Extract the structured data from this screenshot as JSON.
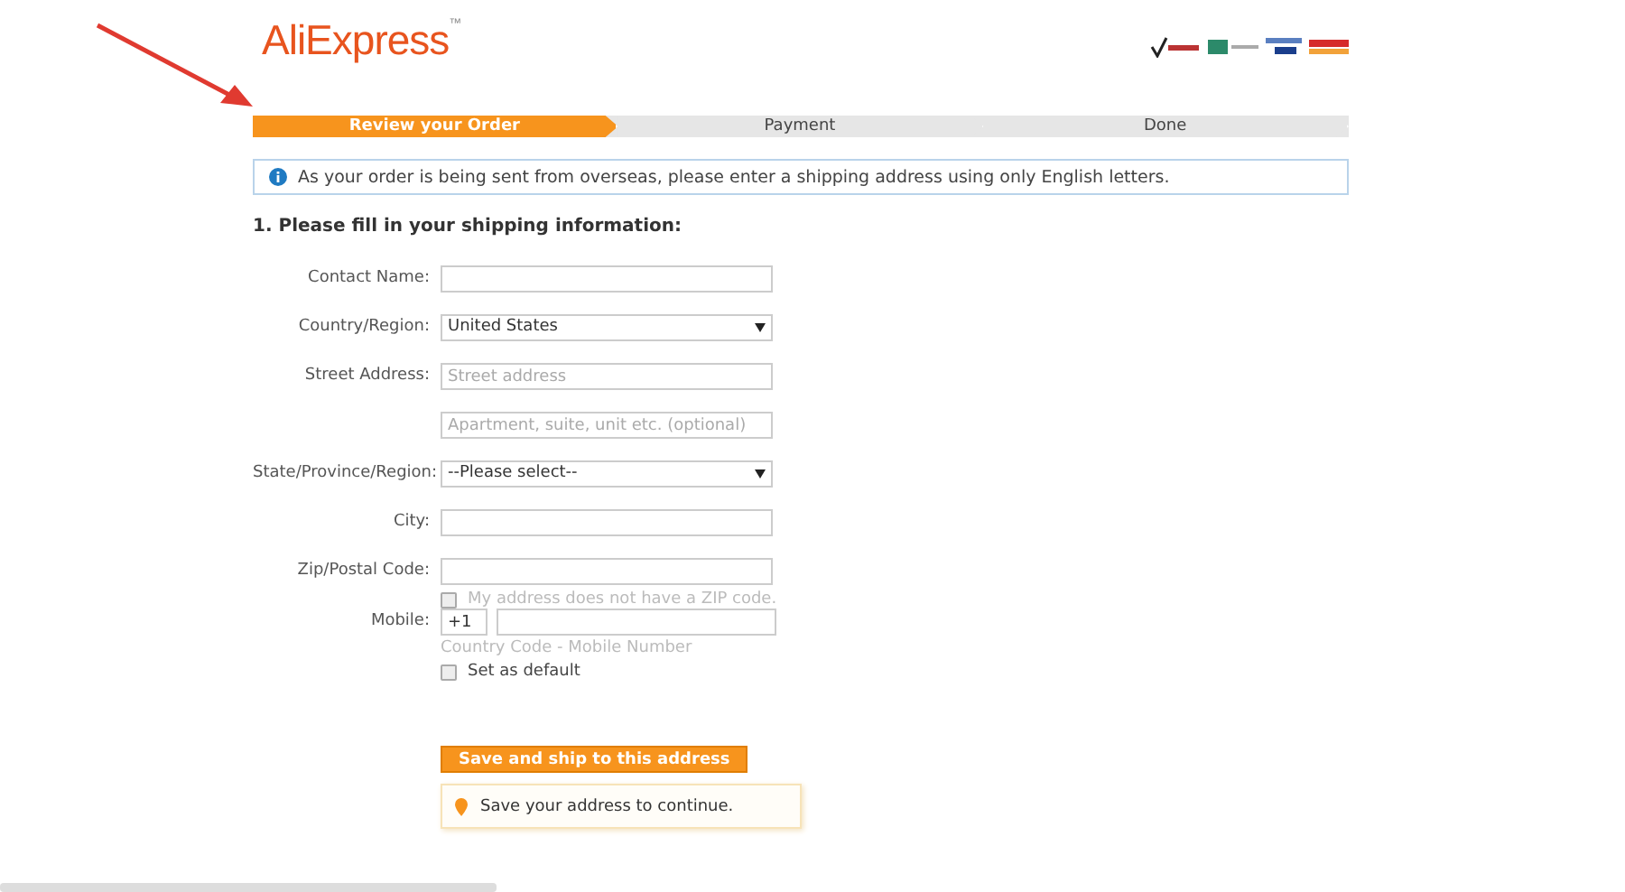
{
  "logo": {
    "text": "AliExpress",
    "mark": "™"
  },
  "steps": [
    {
      "label": "Review your Order",
      "selected": true
    },
    {
      "label": "Payment",
      "selected": false
    },
    {
      "label": "Done",
      "selected": false
    }
  ],
  "notice": "As your order is being sent from overseas, please enter a shipping address using only English letters.",
  "section_title": "1. Please fill in your shipping information:",
  "fields": [
    {
      "kind": "text",
      "label": "Contact Name:"
    },
    {
      "kind": "select",
      "label": "Country/Region:",
      "value": "United States"
    },
    {
      "kind": "text",
      "label": "Street Address:",
      "placeholder": "Street address"
    },
    {
      "kind": "text",
      "placeholder": "Apartment, suite, unit etc. (optional)"
    },
    {
      "kind": "select",
      "label": "State/Province/Region:",
      "value": "--Please select--"
    },
    {
      "kind": "text",
      "label": "City:"
    },
    {
      "kind": "text",
      "label": "Zip/Postal Code:",
      "option": {
        "label": "My address does not have a ZIP code.",
        "checked": false,
        "disabled": true
      }
    },
    {
      "kind": "phone",
      "label": "Mobile:",
      "code": "+1",
      "hint": "Country Code - Mobile Number"
    }
  ],
  "default_option": {
    "label": "Set as default",
    "checked": false,
    "disabled": false
  },
  "submit": "Save and ship to this address",
  "tip": "Save your address to continue."
}
